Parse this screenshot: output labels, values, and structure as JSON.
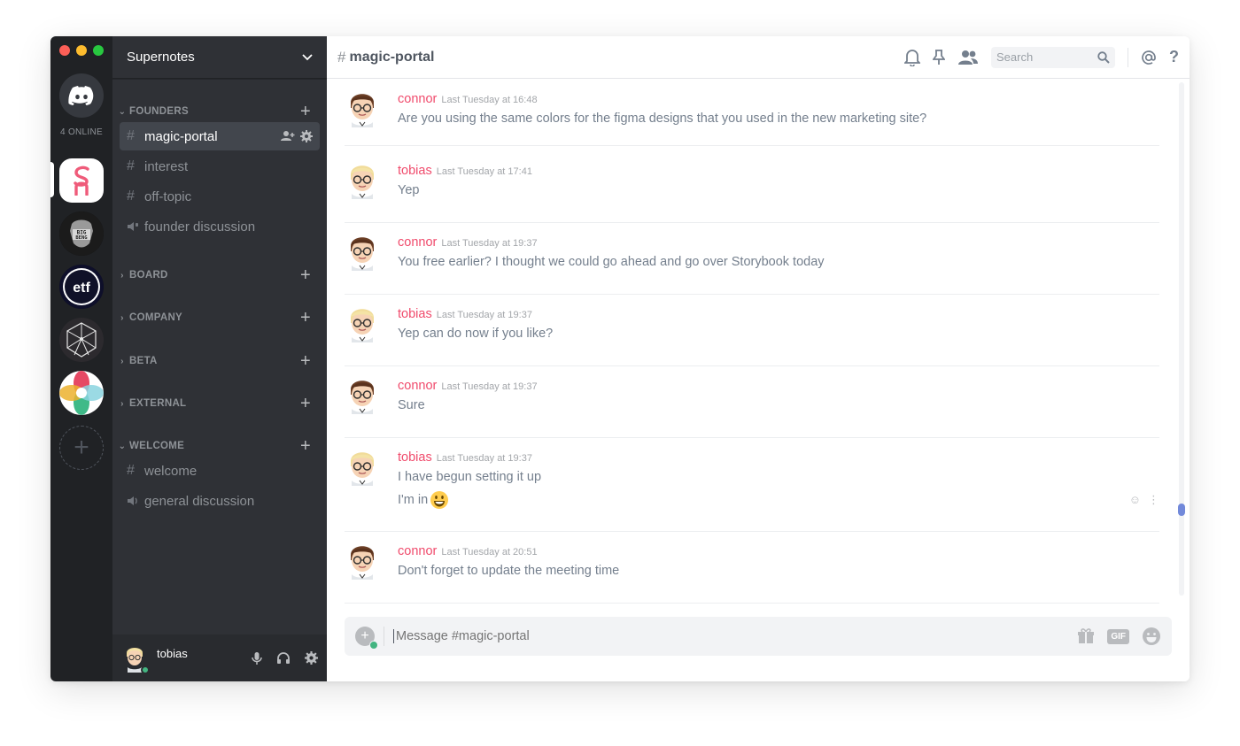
{
  "rail": {
    "online_text": "4 ONLINE"
  },
  "guild": {
    "name": "Supernotes"
  },
  "categories": {
    "founders": "FOUNDERS",
    "board": "BOARD",
    "company": "COMPANY",
    "beta": "BETA",
    "external": "EXTERNAL",
    "welcome": "WELCOME"
  },
  "channels": {
    "magic_portal": "magic-portal",
    "interest": "interest",
    "off_topic": "off-topic",
    "founder_discussion": "founder discussion",
    "welcome": "welcome",
    "general_discussion": "general discussion"
  },
  "user": {
    "name": "tobias",
    "status_color": "#43b581"
  },
  "header": {
    "channel_name": "magic-portal",
    "search_placeholder": "Search"
  },
  "messages": [
    {
      "author": "connor",
      "time": "Last Tuesday at 16:48",
      "lines": [
        "Are you using the same colors for the figma designs that you used in the new marketing site?"
      ]
    },
    {
      "author": "tobias",
      "time": "Last Tuesday at 17:41",
      "lines": [
        "Yep"
      ]
    },
    {
      "author": "connor",
      "time": "Last Tuesday at 19:37",
      "lines": [
        "You free earlier? I thought we could go ahead and go over Storybook today"
      ]
    },
    {
      "author": "tobias",
      "time": "Last Tuesday at 19:37",
      "lines": [
        "Yep can do now if you like?"
      ]
    },
    {
      "author": "connor",
      "time": "Last Tuesday at 19:37",
      "lines": [
        "Sure"
      ]
    },
    {
      "author": "tobias",
      "time": "Last Tuesday at 19:37",
      "lines": [
        "I have begun setting it up",
        "I'm in"
      ]
    },
    {
      "author": "connor",
      "time": "Last Tuesday at 20:51",
      "lines": [
        "Don't forget to update the meeting time"
      ]
    }
  ],
  "composer": {
    "placeholder": "Message #magic-portal",
    "gif_label": "GIF"
  },
  "colors": {
    "accent": "#7289da",
    "author": "#f04b6c",
    "online": "#43b581"
  }
}
